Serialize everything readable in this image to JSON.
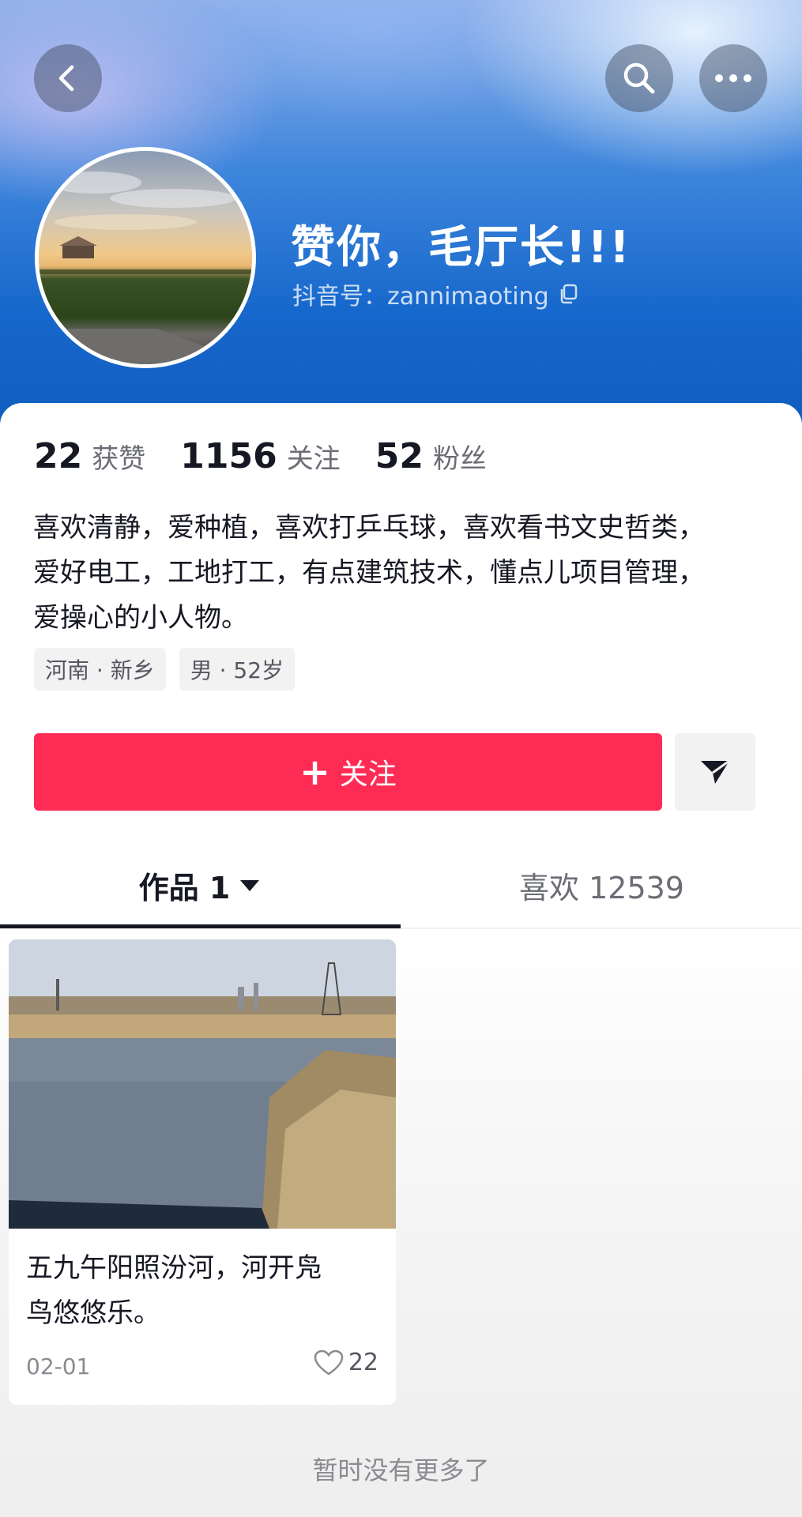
{
  "header": {
    "back_icon": "chevron-left-icon",
    "search_icon": "search-icon",
    "more_icon": "more-dots-icon"
  },
  "profile": {
    "nickname": "赞你，毛厅长!!!",
    "douyin_id": "抖音号：zannimaoting",
    "copy_icon": "copy-icon",
    "stats": [
      {
        "value": "22",
        "label": "获赞"
      },
      {
        "value": "1156",
        "label": "关注"
      },
      {
        "value": "52",
        "label": "粉丝"
      }
    ],
    "bio_lines": [
      "喜欢清静，爱种植，喜欢打乒乓球，喜欢看书文史哲类，",
      "爱好电工，工地打工，有点建筑技术，懂点儿项目管理，",
      "爱操心的小人物。"
    ],
    "tags": [
      "河南 · 新乡",
      "男 · 52岁"
    ]
  },
  "actions": {
    "follow_label": "关注",
    "follow_color": "#fe2c55",
    "share_icon": "send-icon"
  },
  "tabs": [
    {
      "label": "作品 1",
      "active": true
    },
    {
      "label": "喜欢 12539",
      "active": false
    }
  ],
  "videos": [
    {
      "title_lines": [
        "五九午阳照汾河，河开凫",
        "鸟悠悠乐。"
      ],
      "date": "02-01",
      "likes": "22"
    }
  ],
  "footer": {
    "no_more": "暂时没有更多了"
  }
}
